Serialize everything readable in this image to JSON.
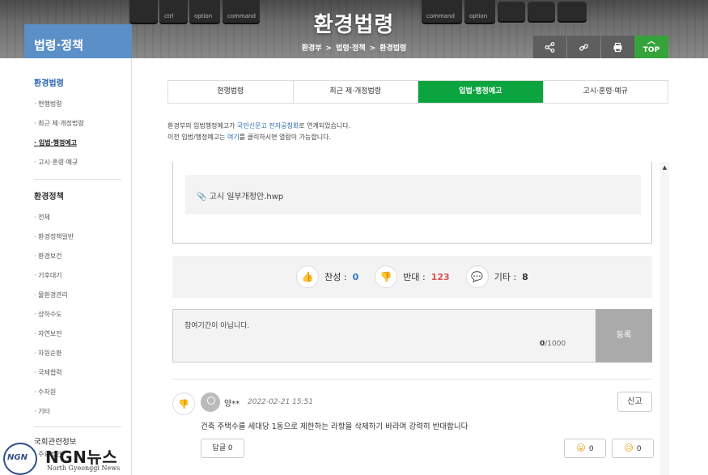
{
  "header": {
    "title": "환경법령",
    "section": "법령·정책",
    "breadcrumb": [
      "환경부",
      "법령·정책",
      "환경법령"
    ],
    "top_label": "TOP",
    "keys": [
      "ctrl",
      "option",
      "command",
      "command",
      "option"
    ]
  },
  "sidebar": {
    "group1_title": "환경법령",
    "group1_items": [
      "현행법령",
      "최근 제·개정법령",
      "입법·행정예고",
      "고시·훈령·예규"
    ],
    "group2_title": "환경정책",
    "group2_items": [
      "전체",
      "환경정책일반",
      "환경보건",
      "기후대기",
      "물환경관리",
      "상하수도",
      "자연보전",
      "자원순환",
      "국제협력",
      "수자원",
      "기타"
    ],
    "group3_title": "국회관련정보",
    "group3_first": "주요법안"
  },
  "tabs": [
    "현행법령",
    "최근 제·개정법령",
    "입법·행정예고",
    "고시·훈령·예규"
  ],
  "notice": {
    "line1_pre": "환경부의 입법행정예고가 ",
    "line1_link": "국민신문고 전자공청회",
    "line1_post": "로 연계되었습니다.",
    "line2_pre": "이전 입법/행정예고는 ",
    "line2_link": "여기",
    "line2_post": "를 클릭하시면 열람이 가능합니다."
  },
  "attachment": "고시 일부개정안.hwp",
  "votes": {
    "agree_label": "찬성 :",
    "agree_count": "0",
    "oppose_label": "반대 :",
    "oppose_count": "123",
    "etc_label": "기타 :",
    "etc_count": "8"
  },
  "comment_form": {
    "message": "참여기간이 아닙니다.",
    "char_count": "0",
    "char_limit": "/1000",
    "submit_label": "등록"
  },
  "comment": {
    "author": "양**",
    "date": "2022-02-21 15:51",
    "report_label": "신고",
    "text": "건축 주택수를 세대당 1동으로 제한하는 라항을 삭제하기 바라며 강력히 반대합니다",
    "reply_label": "답글 0",
    "reaction1_count": "0",
    "reaction2_count": "0"
  },
  "watermark": {
    "logo": "NGN",
    "name": "NGN뉴스",
    "sub": "North Gyeonggi News"
  },
  "colors": {
    "active_tab": "#0ca43e",
    "section_blue": "#5b8fc7",
    "top_green": "#36a33a",
    "oppose_red": "#d9534f",
    "agree_blue": "#2f78c4"
  }
}
